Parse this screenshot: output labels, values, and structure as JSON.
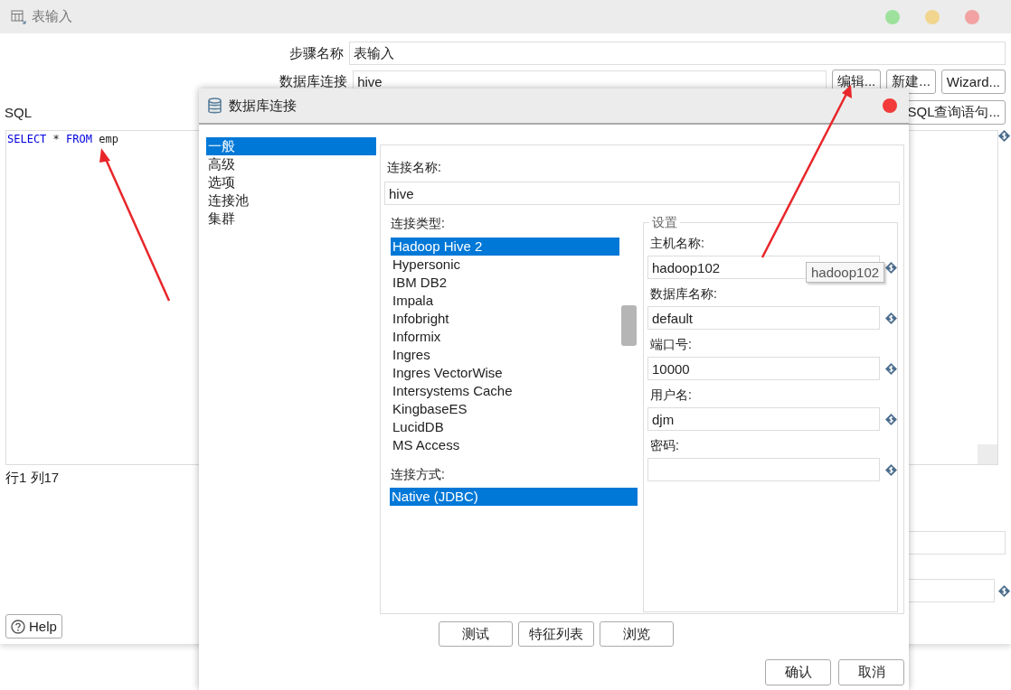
{
  "window": {
    "title": "表输入",
    "controls": [
      {
        "color": "#9de19d"
      },
      {
        "color": "#f2d68f"
      },
      {
        "color": "#f2a2a2"
      }
    ]
  },
  "form": {
    "step_name": {
      "label": "步骤名称",
      "value": "表输入"
    },
    "connection": {
      "label": "数据库连接",
      "value": "hive"
    },
    "connection_buttons": [
      "编辑...",
      "新建...",
      "Wizard..."
    ],
    "sql_label": "SQL",
    "sql_button": "SQL查询语句...",
    "sql": [
      {
        "text": "SELECT",
        "kind": "keyword"
      },
      {
        "text": "*",
        "kind": "plain"
      },
      {
        "text": "FROM",
        "kind": "keyword"
      },
      {
        "text": "emp",
        "kind": "plain"
      }
    ],
    "status": "行1 列17",
    "help": "Help"
  },
  "dialog": {
    "title": "数据库连接",
    "nav": [
      {
        "label": "一般",
        "selected": true
      },
      {
        "label": "高级",
        "selected": false
      },
      {
        "label": "选项",
        "selected": false
      },
      {
        "label": "连接池",
        "selected": false
      },
      {
        "label": "集群",
        "selected": false
      }
    ],
    "connection_name": {
      "label": "连接名称:",
      "value": "hive"
    },
    "connection_type": {
      "label": "连接类型:",
      "items": [
        {
          "label": "Hadoop Hive 2",
          "selected": true
        },
        {
          "label": "Hypersonic",
          "selected": false
        },
        {
          "label": "IBM DB2",
          "selected": false
        },
        {
          "label": "Impala",
          "selected": false
        },
        {
          "label": "Infobright",
          "selected": false
        },
        {
          "label": "Informix",
          "selected": false
        },
        {
          "label": "Ingres",
          "selected": false
        },
        {
          "label": "Ingres VectorWise",
          "selected": false
        },
        {
          "label": "Intersystems Cache",
          "selected": false
        },
        {
          "label": "KingbaseES",
          "selected": false
        },
        {
          "label": "LucidDB",
          "selected": false
        },
        {
          "label": "MS Access",
          "selected": false
        }
      ]
    },
    "access": {
      "label": "连接方式:",
      "items": [
        {
          "label": "Native (JDBC)",
          "selected": true
        }
      ]
    },
    "settings": {
      "title": "设置",
      "fields": [
        {
          "label": "主机名称:",
          "value": "hadoop102"
        },
        {
          "label": "数据库名称:",
          "value": "default"
        },
        {
          "label": "端口号:",
          "value": "10000"
        },
        {
          "label": "用户名:",
          "value": "djm"
        },
        {
          "label": "密码:"
        }
      ]
    },
    "tooltip": "hadoop102",
    "buttons": [
      "测试",
      "特征列表",
      "浏览"
    ],
    "footer_buttons": [
      "确认",
      "取消"
    ]
  }
}
